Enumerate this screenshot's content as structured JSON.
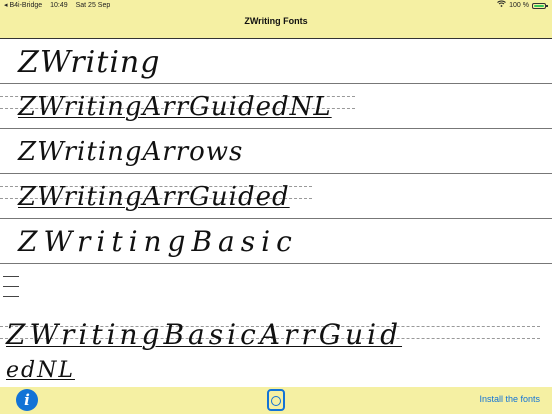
{
  "status_bar": {
    "back_label": "◂ B4i-Bridge",
    "time": "10:49",
    "date": "Sat 25 Sep",
    "battery_percent": "100 %"
  },
  "nav": {
    "title": "ZWriting Fonts"
  },
  "fonts": [
    {
      "sample": "ZWriting"
    },
    {
      "sample": "ZWritingArrGuidedNL"
    },
    {
      "sample": "ZWritingArrows"
    },
    {
      "sample": "ZWritingArrGuided"
    },
    {
      "sample": "ZWritingBasic"
    },
    {
      "sample": "ZWritingBasicArrGuid"
    },
    {
      "sample": "edNL"
    }
  ],
  "toolbar": {
    "install_label": "Install the fonts",
    "info_glyph": "i"
  },
  "colors": {
    "background": "#f5f0a3",
    "accent": "#1273d6"
  }
}
